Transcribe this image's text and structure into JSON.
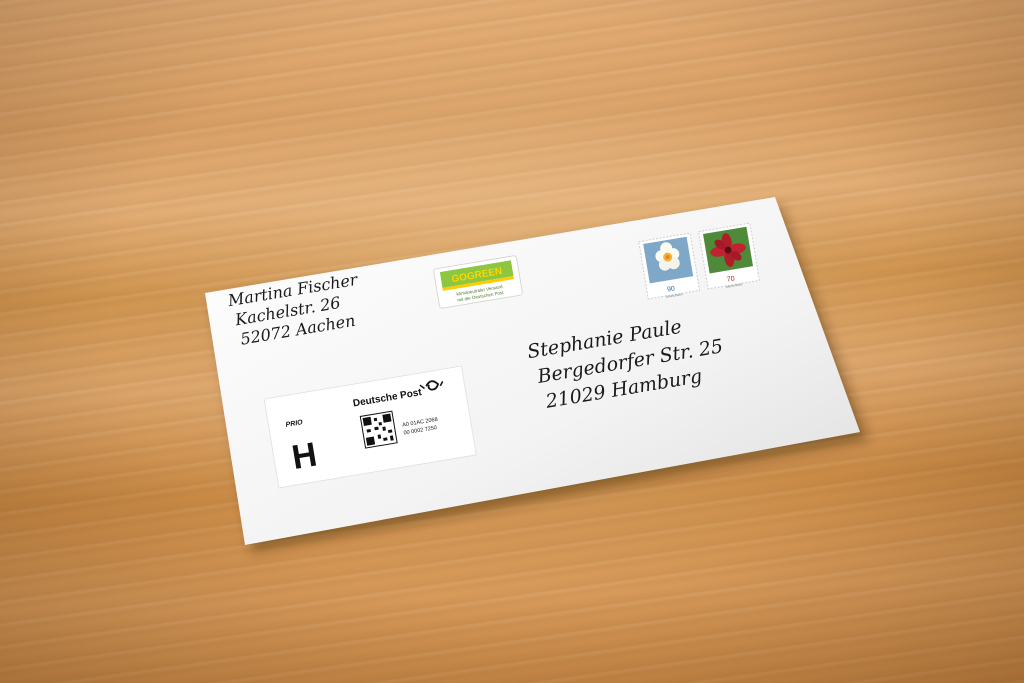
{
  "sender": {
    "line1": "Martina Fischer",
    "line2": "Kachelstr. 26",
    "line3": "52072 Aachen"
  },
  "recipient": {
    "line1": "Stephanie Paule",
    "line2": "Bergedorfer Str. 25",
    "line3": "21029 Hamburg"
  },
  "gogreen": {
    "logo": "GOGREEN",
    "caption1": "Klimaneutraler Versand",
    "caption2": "mit der Deutschen Post"
  },
  "stamps": [
    {
      "value": "90",
      "country": "Deutschland",
      "motif": "daffodil-flower"
    },
    {
      "value": "70",
      "country": "Deutschland",
      "motif": "red-flower"
    }
  ],
  "label": {
    "prio": "PRIO",
    "product_code": "H",
    "brand": "Deutsche Post",
    "code_line1": "A0 01AC 2068",
    "code_line2": "00 0002 7250",
    "brand_icon": "post-horn-icon"
  },
  "colors": {
    "wood": "#d9a066",
    "envelope": "#f7f7f7",
    "gogreen_green": "#8dc63f",
    "gogreen_yellow": "#ffcc00"
  }
}
